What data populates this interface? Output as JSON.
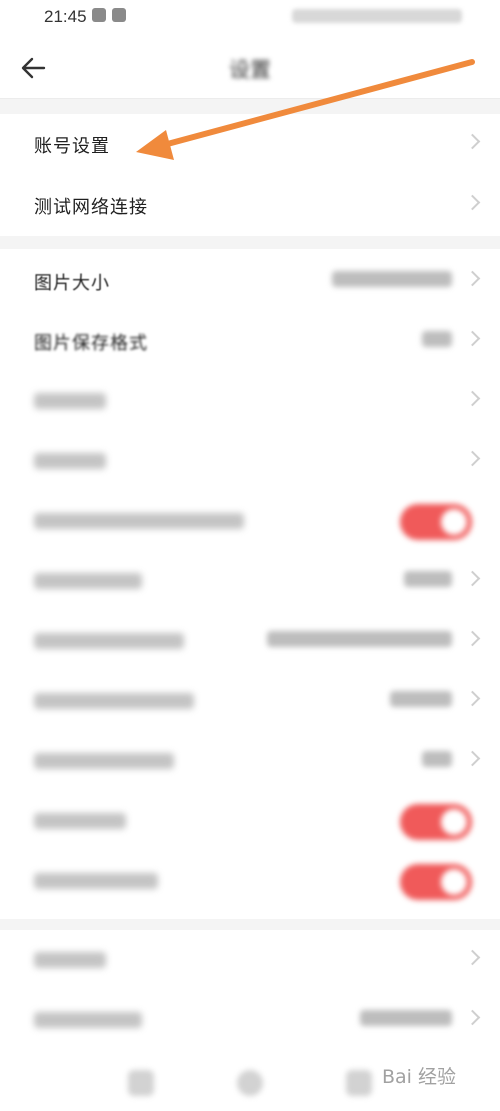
{
  "status_bar": {
    "time": "21:45"
  },
  "header": {
    "title": "设置"
  },
  "section1": {
    "items": [
      {
        "label": "账号设置"
      },
      {
        "label": "测试网络连接"
      }
    ]
  },
  "section2": {
    "items": [
      {
        "label": "图片大小"
      },
      {
        "label": "图片保存格式"
      }
    ]
  },
  "annotation": {
    "arrow_color": "#f08a3c"
  },
  "watermark": {
    "text": "Bai 经验"
  },
  "colors": {
    "toggle_on": "#f05a5a",
    "background": "#f4f4f4"
  }
}
